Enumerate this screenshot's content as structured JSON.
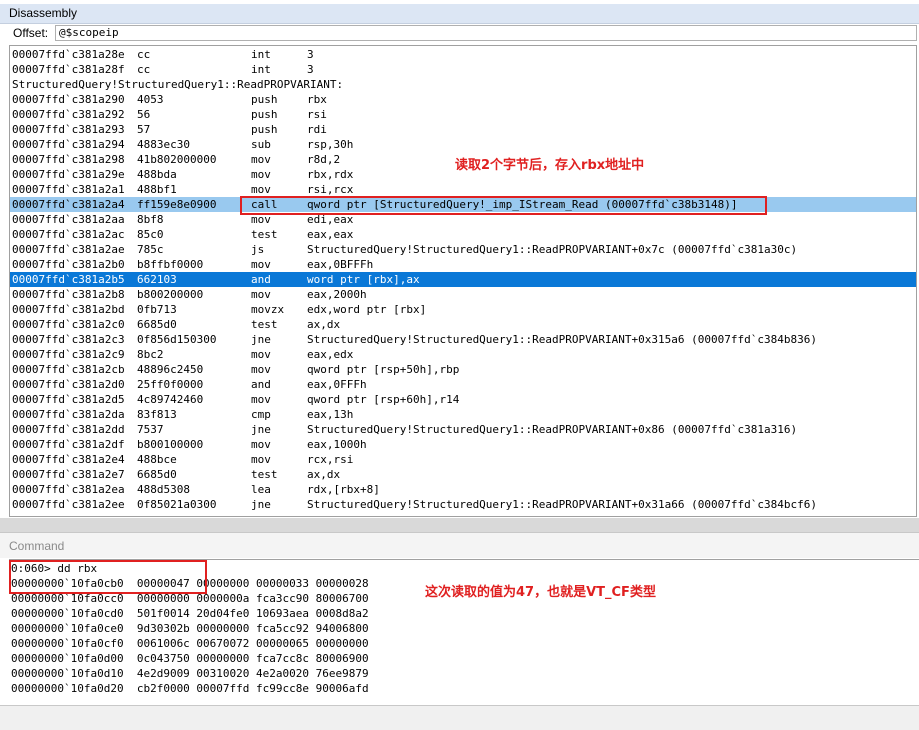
{
  "disassembly": {
    "title": "Disassembly",
    "offset_label": "Offset:",
    "offset_value": "@$scopeip",
    "rows": [
      {
        "addr": "00007ffd`c381a28e",
        "bytes": "cc",
        "mn": "int",
        "op": "3"
      },
      {
        "addr": "00007ffd`c381a28f",
        "bytes": "cc",
        "mn": "int",
        "op": "3"
      },
      {
        "label": "StructuredQuery!StructuredQuery1::ReadPROPVARIANT:"
      },
      {
        "addr": "00007ffd`c381a290",
        "bytes": "4053",
        "mn": "push",
        "op": "rbx"
      },
      {
        "addr": "00007ffd`c381a292",
        "bytes": "56",
        "mn": "push",
        "op": "rsi"
      },
      {
        "addr": "00007ffd`c381a293",
        "bytes": "57",
        "mn": "push",
        "op": "rdi"
      },
      {
        "addr": "00007ffd`c381a294",
        "bytes": "4883ec30",
        "mn": "sub",
        "op": "rsp,30h"
      },
      {
        "addr": "00007ffd`c381a298",
        "bytes": "41b802000000",
        "mn": "mov",
        "op": "r8d,2"
      },
      {
        "addr": "00007ffd`c381a29e",
        "bytes": "488bda",
        "mn": "mov",
        "op": "rbx,rdx"
      },
      {
        "addr": "00007ffd`c381a2a1",
        "bytes": "488bf1",
        "mn": "mov",
        "op": "rsi,rcx"
      },
      {
        "addr": "00007ffd`c381a2a4",
        "bytes": "ff159e8e0900",
        "mn": "call",
        "op": "qword ptr [StructuredQuery!_imp_IStream_Read (00007ffd`c38b3148)]",
        "state": "cur"
      },
      {
        "addr": "00007ffd`c381a2aa",
        "bytes": "8bf8",
        "mn": "mov",
        "op": "edi,eax"
      },
      {
        "addr": "00007ffd`c381a2ac",
        "bytes": "85c0",
        "mn": "test",
        "op": "eax,eax"
      },
      {
        "addr": "00007ffd`c381a2ae",
        "bytes": "785c",
        "mn": "js",
        "op": "StructuredQuery!StructuredQuery1::ReadPROPVARIANT+0x7c (00007ffd`c381a30c)"
      },
      {
        "addr": "00007ffd`c381a2b0",
        "bytes": "b8ffbf0000",
        "mn": "mov",
        "op": "eax,0BFFFh"
      },
      {
        "addr": "00007ffd`c381a2b5",
        "bytes": "662103",
        "mn": "and",
        "op": "word ptr [rbx],ax",
        "state": "sel"
      },
      {
        "addr": "00007ffd`c381a2b8",
        "bytes": "b800200000",
        "mn": "mov",
        "op": "eax,2000h"
      },
      {
        "addr": "00007ffd`c381a2bd",
        "bytes": "0fb713",
        "mn": "movzx",
        "op": "edx,word ptr [rbx]"
      },
      {
        "addr": "00007ffd`c381a2c0",
        "bytes": "6685d0",
        "mn": "test",
        "op": "ax,dx"
      },
      {
        "addr": "00007ffd`c381a2c3",
        "bytes": "0f856d150300",
        "mn": "jne",
        "op": "StructuredQuery!StructuredQuery1::ReadPROPVARIANT+0x315a6 (00007ffd`c384b836)"
      },
      {
        "addr": "00007ffd`c381a2c9",
        "bytes": "8bc2",
        "mn": "mov",
        "op": "eax,edx"
      },
      {
        "addr": "00007ffd`c381a2cb",
        "bytes": "48896c2450",
        "mn": "mov",
        "op": "qword ptr [rsp+50h],rbp"
      },
      {
        "addr": "00007ffd`c381a2d0",
        "bytes": "25ff0f0000",
        "mn": "and",
        "op": "eax,0FFFh"
      },
      {
        "addr": "00007ffd`c381a2d5",
        "bytes": "4c89742460",
        "mn": "mov",
        "op": "qword ptr [rsp+60h],r14"
      },
      {
        "addr": "00007ffd`c381a2da",
        "bytes": "83f813",
        "mn": "cmp",
        "op": "eax,13h"
      },
      {
        "addr": "00007ffd`c381a2dd",
        "bytes": "7537",
        "mn": "jne",
        "op": "StructuredQuery!StructuredQuery1::ReadPROPVARIANT+0x86 (00007ffd`c381a316)"
      },
      {
        "addr": "00007ffd`c381a2df",
        "bytes": "b800100000",
        "mn": "mov",
        "op": "eax,1000h"
      },
      {
        "addr": "00007ffd`c381a2e4",
        "bytes": "488bce",
        "mn": "mov",
        "op": "rcx,rsi"
      },
      {
        "addr": "00007ffd`c381a2e7",
        "bytes": "6685d0",
        "mn": "test",
        "op": "ax,dx"
      },
      {
        "addr": "00007ffd`c381a2ea",
        "bytes": "488d5308",
        "mn": "lea",
        "op": "rdx,[rbx+8]"
      },
      {
        "addr": "00007ffd`c381a2ee",
        "bytes": "0f85021a0300",
        "mn": "jne",
        "op": "StructuredQuery!StructuredQuery1::ReadPROPVARIANT+0x31a66 (00007ffd`c384bcf6)"
      }
    ],
    "annotation": "读取2个字节后，存入rbx地址中"
  },
  "command": {
    "title": "Command",
    "lines": [
      "0:060> dd rbx",
      "00000000`10fa0cb0  00000047 00000000 00000033 00000028",
      "00000000`10fa0cc0  00000000 0000000a fca3cc90 80006700",
      "00000000`10fa0cd0  501f0014 20d04fe0 10693aea 0008d8a2",
      "00000000`10fa0ce0  9d30302b 00000000 fca5cc92 94006800",
      "00000000`10fa0cf0  0061006c 00670072 00000065 00000000",
      "00000000`10fa0d00  0c043750 00000000 fca7cc8c 80006900",
      "00000000`10fa0d10  4e2d9009 00310020 4e2a0020 76ee9879",
      "00000000`10fa0d20  cb2f0000 00007ffd fc99cc8e 90006afd"
    ],
    "annotation": "这次读取的值为47，也就是VT_CF类型"
  },
  "colors": {
    "annotation": "#e02020",
    "current_line": "#99c9ef",
    "selected_line": "#0a78d7",
    "title_bar": "#dce6f4"
  }
}
